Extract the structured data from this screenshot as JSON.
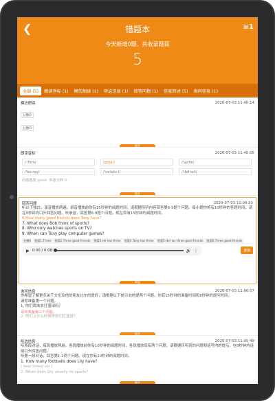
{
  "header": {
    "back_icon": "back-arrow-icon",
    "title": "错题本",
    "menu_label": "≡1",
    "subtitle": "今天新增0题，共收录题目",
    "total": "5"
  },
  "tabs": [
    {
      "label": "全部 (5)",
      "active": true
    },
    {
      "label": "朗读音标 (1)"
    },
    {
      "label": "模仿朗读 (1)"
    },
    {
      "label": "听选信息 (1)"
    },
    {
      "label": "回答问题 (1)"
    },
    {
      "label": "信息转述 (5)"
    },
    {
      "label": "询问信息 (1)"
    }
  ],
  "cards": {
    "c1": {
      "title": "模仿朗读",
      "time": "2020-07-03 11:40:14",
      "score1": "分数0",
      "score2": "分数0",
      "expand": "展开"
    },
    "c2": {
      "title": "朗读音标",
      "time": "2020-07-03 11:40:05",
      "phonetics": [
        "/ ifem/",
        "/gredi/",
        "/'spike/",
        "/'bo:ray/",
        "/'velabo l/",
        "/'defneli/"
      ],
      "hint": "问题答案 great, 伴答分数 0",
      "expand": "展开"
    },
    "c3": {
      "title": "回答问题",
      "time": "2020-07-03 11:06:33",
      "para": "听以下独白，录音播放两遍。录音播放前你有15秒钟的阅题时间，请根据所听内容回答第6-9题个问题。每小题你将有10秒钟的答题时间，请在8秒钟内口头回答问题。听录音，回答第6-9题个问题。现在你有15秒钟的阅题时间。",
      "q6": "6.How many good friends does Tony have？",
      "q7": "7. What does Bob think of sports?",
      "q8": "8. Who only watches sports on TV?",
      "q9": "9. When can Tony play computer games?",
      "answers": [
        "分数6",
        "答案1.Three",
        "答案2.Three good friends",
        "答案3.He has three",
        "答案4.Tony has three",
        "答案5.He has three good friends",
        "答案6.Three good friends"
      ],
      "player_time": "0:00 / 0:08",
      "play_icon": "play-icon",
      "volume_icon": "volume-icon",
      "more_icon": "more-vert-icon",
      "redo": "重做",
      "expand": "收起"
    },
    "c4": {
      "title": "询问信息",
      "time": "2020-07-03 11:06:07",
      "para": "你希望了解更多关于文伦及他的朋友比尔的爱好，请根据以下提示向他提两个问题。你有15秒钟的准备时间和8秒钟的提问时间。",
      "line2": "请你准备第一个问题。",
      "q1": "1. 你们周末去打篮球吗？",
      "red": "请你准备第二个问题。",
      "q2": "2. 你们上什么时候学你们打篮球？",
      "expand": "展开"
    },
    "c5": {
      "title": "听选信息",
      "time": "2020-07-03 11:05:49",
      "para": "听两段对话，每段播放两遍。各段播放前你有10秒钟的阅题时间，各段播放后有两个问题，请根据所听到的问题和括号内的提示，在8秒钟内连接口头回答问题。",
      "line2": "听第一段对话，回答第1-2两个问题。现在你有10秒钟的阅题时间。",
      "q1": "1. How many footballs does Lily have?",
      "hint1": "( two/ three/ six )",
      "q2": "2. When does Lily usually do sports?",
      "expand": "展开"
    }
  },
  "colors": {
    "accent": "#f08a16",
    "tab_bar": "#d86f07"
  }
}
